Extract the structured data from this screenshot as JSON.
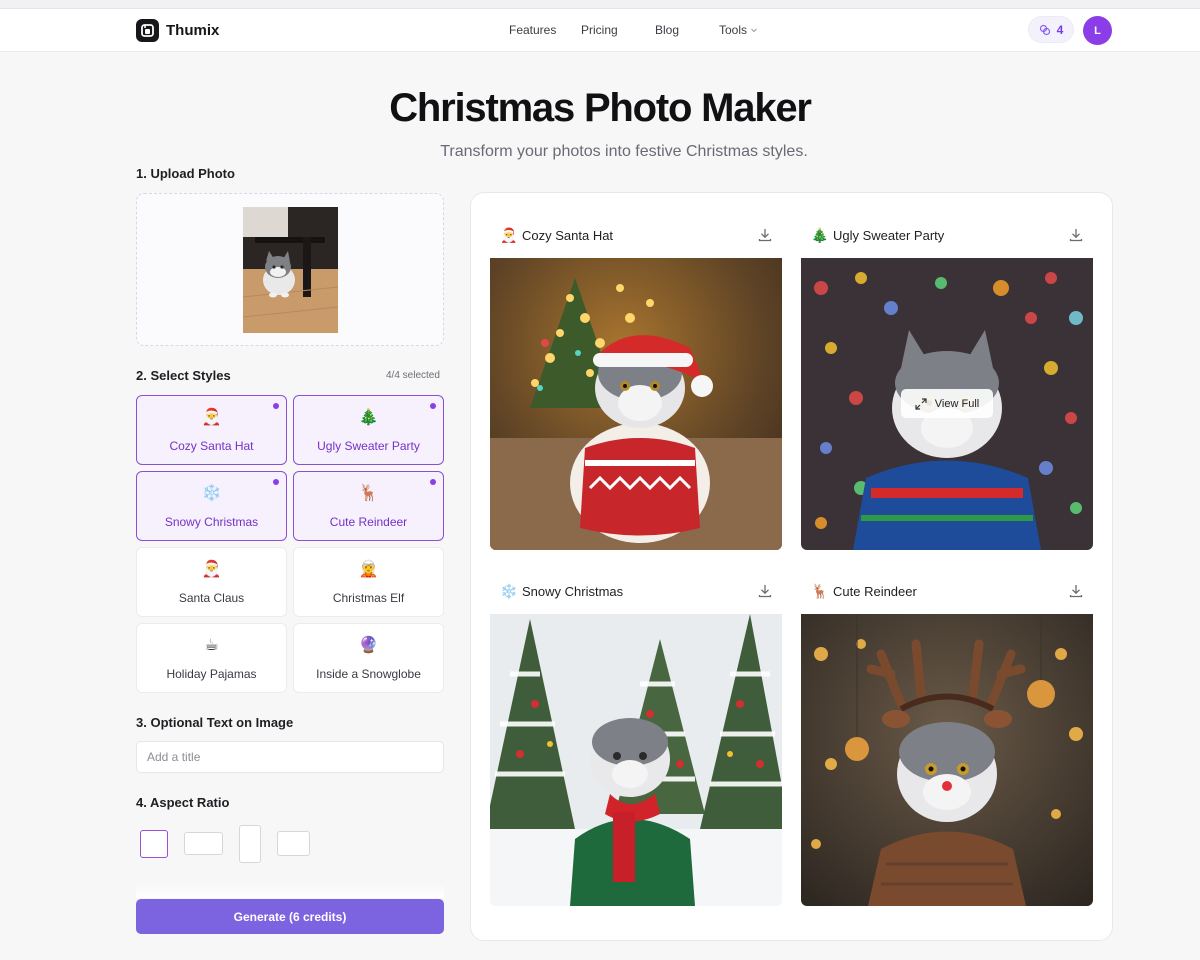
{
  "nav": {
    "brand": "Thumix",
    "links": [
      "Features",
      "Pricing",
      "Blog"
    ],
    "tools_label": "Tools",
    "credits": "4",
    "avatar_initial": "L"
  },
  "hero": {
    "title": "Christmas Photo Maker",
    "subtitle": "Transform your photos into festive Christmas styles."
  },
  "steps": {
    "upload": "1. Upload Photo",
    "styles": "2. Select Styles",
    "styles_count": "4/4 selected",
    "text": "3. Optional Text on Image",
    "aspect": "4. Aspect Ratio"
  },
  "styles": [
    {
      "emoji": "🎅",
      "label": "Cozy Santa Hat",
      "selected": true
    },
    {
      "emoji": "🎄",
      "label": "Ugly Sweater Party",
      "selected": true
    },
    {
      "emoji": "❄️",
      "label": "Snowy Christmas",
      "selected": true
    },
    {
      "emoji": "🦌",
      "label": "Cute Reindeer",
      "selected": true
    },
    {
      "emoji": "🎅",
      "label": "Santa Claus",
      "selected": false
    },
    {
      "emoji": "🧝",
      "label": "Christmas Elf",
      "selected": false
    },
    {
      "emoji": "☕",
      "label": "Holiday Pajamas",
      "selected": false
    },
    {
      "emoji": "🔮",
      "label": "Inside a Snowglobe",
      "selected": false
    }
  ],
  "text_input": {
    "placeholder": "Add a title",
    "value": ""
  },
  "aspect_ratios": [
    {
      "name": "square",
      "selected": true
    },
    {
      "name": "landscape",
      "selected": false
    },
    {
      "name": "portrait",
      "selected": false
    },
    {
      "name": "wide",
      "selected": false
    }
  ],
  "generate_button": "Generate (6 credits)",
  "results": [
    {
      "emoji": "🎅",
      "title": "Cozy Santa Hat"
    },
    {
      "emoji": "🎄",
      "title": "Ugly Sweater Party",
      "overlay": "View Full"
    },
    {
      "emoji": "❄️",
      "title": "Snowy Christmas"
    },
    {
      "emoji": "🦌",
      "title": "Cute Reindeer"
    }
  ],
  "colors": {
    "accent": "#7c63e0",
    "selected_border": "#8b4ed6",
    "avatar": "#8b3de8"
  },
  "icons": [
    "brand-logo-icon",
    "credits-icon",
    "chevron-down-icon",
    "download-icon",
    "expand-icon"
  ]
}
